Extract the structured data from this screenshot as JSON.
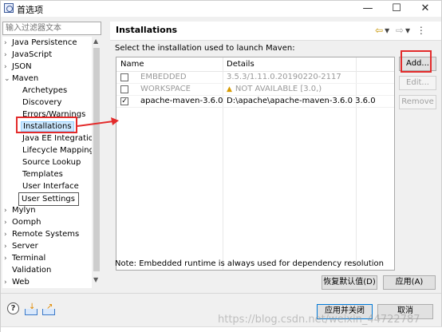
{
  "window": {
    "title": "首选项",
    "controls": {
      "minimize": "—",
      "maximize": "☐",
      "close": "✕"
    }
  },
  "sidebar": {
    "filter_placeholder": "输入过滤器文本",
    "items": [
      {
        "label": "Java Persistence",
        "arrow": "›",
        "level": 0
      },
      {
        "label": "JavaScript",
        "arrow": "›",
        "level": 0
      },
      {
        "label": "JSON",
        "arrow": "›",
        "level": 0
      },
      {
        "label": "Maven",
        "arrow": "⌄",
        "level": 0
      },
      {
        "label": "Archetypes",
        "arrow": "",
        "level": 1
      },
      {
        "label": "Discovery",
        "arrow": "",
        "level": 1
      },
      {
        "label": "Errors/Warnings",
        "arrow": "",
        "level": 1
      },
      {
        "label": "Installations",
        "arrow": "",
        "level": 1
      },
      {
        "label": "Java EE Integration",
        "arrow": "",
        "level": 1
      },
      {
        "label": "Lifecycle Mappings",
        "arrow": "",
        "level": 1
      },
      {
        "label": "Source Lookup",
        "arrow": "",
        "level": 1
      },
      {
        "label": "Templates",
        "arrow": "",
        "level": 1
      },
      {
        "label": "User Interface",
        "arrow": "",
        "level": 1
      },
      {
        "label": "User Settings",
        "arrow": "",
        "level": 1
      },
      {
        "label": "Mylyn",
        "arrow": "›",
        "level": 0
      },
      {
        "label": "Oomph",
        "arrow": "›",
        "level": 0
      },
      {
        "label": "Remote Systems",
        "arrow": "›",
        "level": 0
      },
      {
        "label": "Server",
        "arrow": "›",
        "level": 0
      },
      {
        "label": "Terminal",
        "arrow": "›",
        "level": 0
      },
      {
        "label": "Validation",
        "arrow": "",
        "level": 0
      },
      {
        "label": "Web",
        "arrow": "›",
        "level": 0
      }
    ]
  },
  "page": {
    "title": "Installations",
    "description": "Select the installation used to launch Maven:",
    "columns": {
      "name": "Name",
      "details": "Details"
    },
    "rows": [
      {
        "checked": false,
        "name": "EMBEDDED",
        "details": "3.5.3/1.11.0.20190220-2117",
        "disabled": true,
        "warning": false
      },
      {
        "checked": false,
        "name": "WORKSPACE",
        "details": "NOT AVAILABLE [3.0,)",
        "disabled": true,
        "warning": true
      },
      {
        "checked": true,
        "name": "apache-maven-3.6.0",
        "details": "D:\\apache\\apache-maven-3.6.0 3.6.0",
        "disabled": false,
        "warning": false
      }
    ],
    "buttons": {
      "add": "Add...",
      "edit": "Edit...",
      "remove": "Remove"
    },
    "note": "Note: Embedded runtime is always used for dependency resolution",
    "restore_defaults": "恢复默认值(D)",
    "apply": "应用(A)"
  },
  "footer": {
    "apply_close": "应用并关闭",
    "cancel": "取消"
  },
  "watermark": "https://blog.csdn.net/weixin_44722787",
  "colors": {
    "annotation": "#e32b2b",
    "selection": "#cce8ff"
  }
}
